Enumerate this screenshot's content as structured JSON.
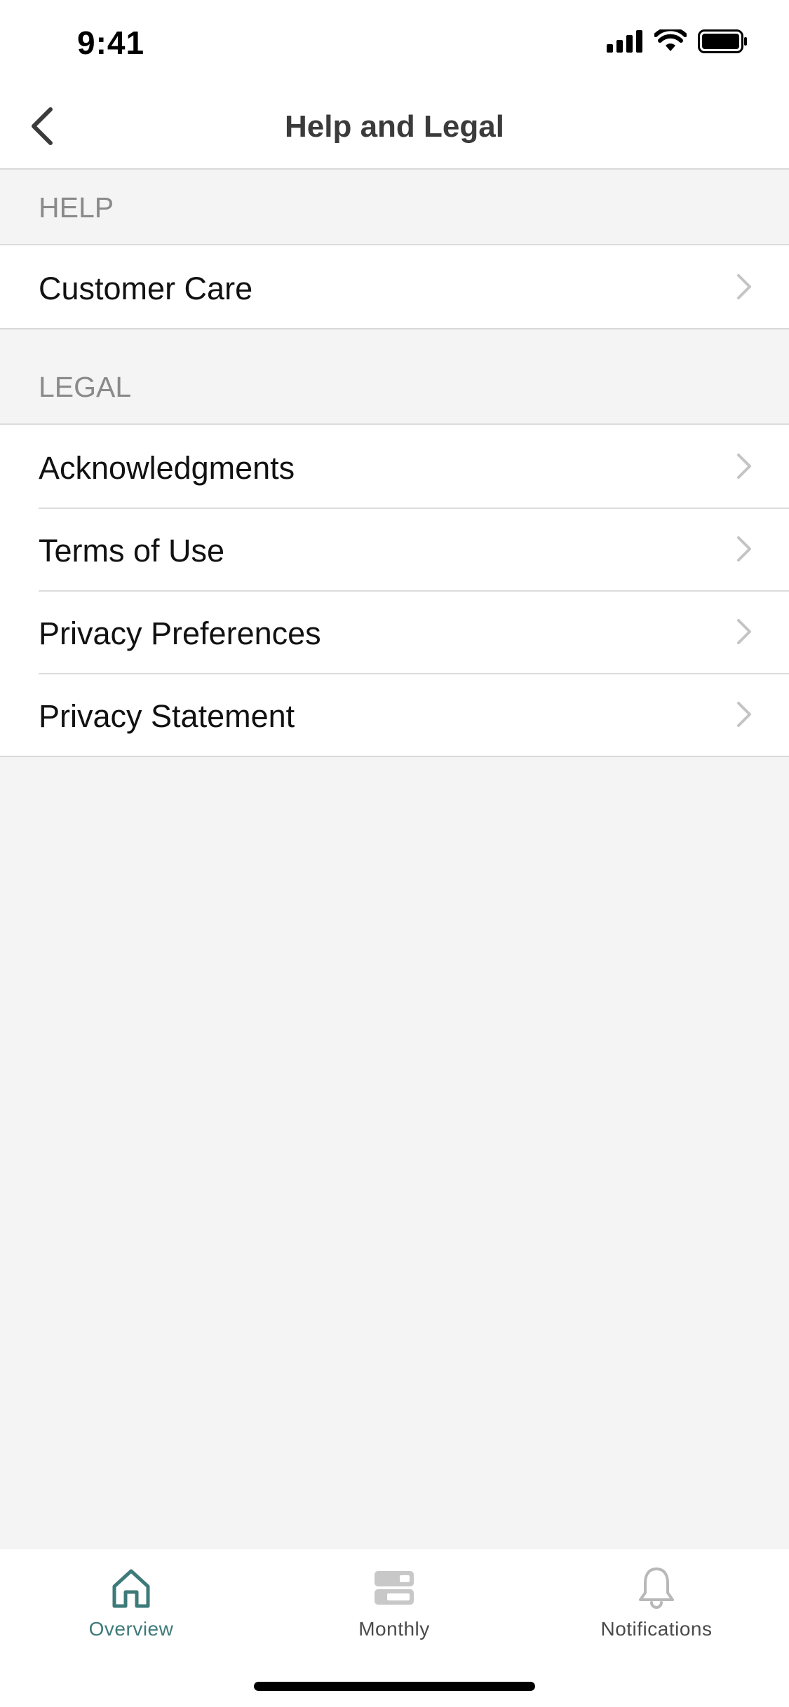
{
  "status_bar": {
    "time": "9:41"
  },
  "nav": {
    "title": "Help and Legal"
  },
  "sections": [
    {
      "header": "HELP",
      "items": [
        "Customer Care"
      ]
    },
    {
      "header": "LEGAL",
      "items": [
        "Acknowledgments",
        "Terms of Use",
        "Privacy Preferences",
        "Privacy Statement"
      ]
    }
  ],
  "tabs": [
    {
      "label": "Overview",
      "icon": "home-icon",
      "active": true
    },
    {
      "label": "Monthly",
      "icon": "monthly-icon",
      "active": false
    },
    {
      "label": "Notifications",
      "icon": "bell-icon",
      "active": false
    }
  ],
  "colors": {
    "accent": "#3e7a7a",
    "background": "#f4f4f4"
  }
}
